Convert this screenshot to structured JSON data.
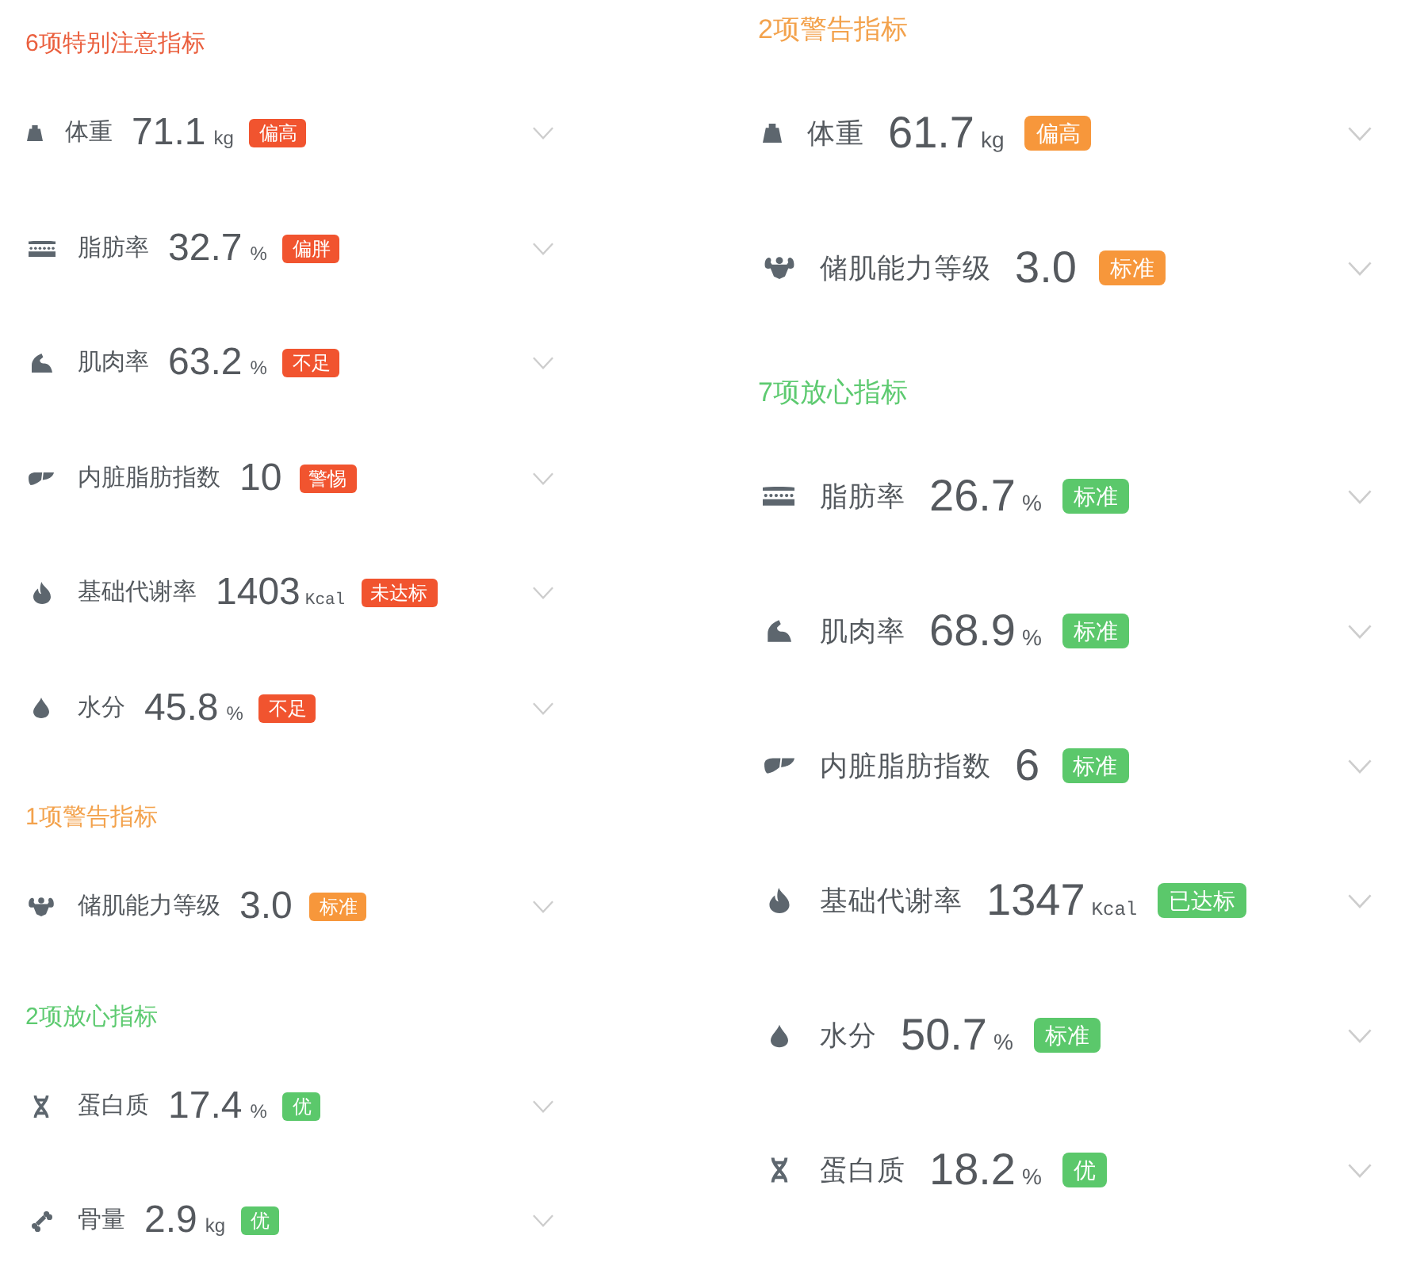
{
  "panels": [
    {
      "sections": [
        {
          "kind": "attention",
          "title": "6项特别注意指标",
          "items": [
            {
              "kind": "weight",
              "label": "体重",
              "value": "71.1",
              "unit": "kg",
              "badge": "偏高"
            },
            {
              "kind": "body_fat",
              "label": "脂肪率",
              "value": "32.7",
              "unit": "%",
              "badge": "偏胖"
            },
            {
              "kind": "muscle",
              "label": "肌肉率",
              "value": "63.2",
              "unit": "%",
              "badge": "不足"
            },
            {
              "kind": "visceral_fat",
              "label": "内脏脂肪指数",
              "value": "10",
              "badge": "警惕"
            },
            {
              "kind": "bmr",
              "label": "基础代谢率",
              "value": "1403",
              "unit": "Kcal",
              "badge": "未达标"
            },
            {
              "kind": "water",
              "label": "水分",
              "value": "45.8",
              "unit": "%",
              "badge": "不足"
            }
          ]
        },
        {
          "kind": "warning",
          "title": "1项警告指标",
          "items": [
            {
              "kind": "muscle_storage",
              "label": "储肌能力等级",
              "value": "3.0",
              "badge": "标准"
            }
          ]
        },
        {
          "kind": "safe",
          "title": "2项放心指标",
          "items": [
            {
              "kind": "protein",
              "label": "蛋白质",
              "value": "17.4",
              "unit": "%",
              "badge": "优"
            },
            {
              "kind": "bone",
              "label": "骨量",
              "value": "2.9",
              "unit": "kg",
              "badge": "优"
            }
          ]
        }
      ]
    },
    {
      "sections": [
        {
          "kind": "warning",
          "title": "2项警告指标",
          "items": [
            {
              "kind": "weight",
              "label": "体重",
              "value": "61.7",
              "unit": "kg",
              "badge": "偏高"
            },
            {
              "kind": "muscle_storage",
              "label": "储肌能力等级",
              "value": "3.0",
              "badge": "标准"
            }
          ]
        },
        {
          "kind": "safe",
          "title": "7项放心指标",
          "items": [
            {
              "kind": "body_fat",
              "label": "脂肪率",
              "value": "26.7",
              "unit": "%",
              "badge": "标准"
            },
            {
              "kind": "muscle",
              "label": "肌肉率",
              "value": "68.9",
              "unit": "%",
              "badge": "标准"
            },
            {
              "kind": "visceral_fat",
              "label": "内脏脂肪指数",
              "value": "6",
              "badge": "标准"
            },
            {
              "kind": "bmr",
              "label": "基础代谢率",
              "value": "1347",
              "unit": "Kcal",
              "badge": "已达标"
            },
            {
              "kind": "water",
              "label": "水分",
              "value": "50.7",
              "unit": "%",
              "badge": "标准"
            },
            {
              "kind": "protein",
              "label": "蛋白质",
              "value": "18.2",
              "unit": "%",
              "badge": "优"
            }
          ]
        }
      ]
    }
  ]
}
